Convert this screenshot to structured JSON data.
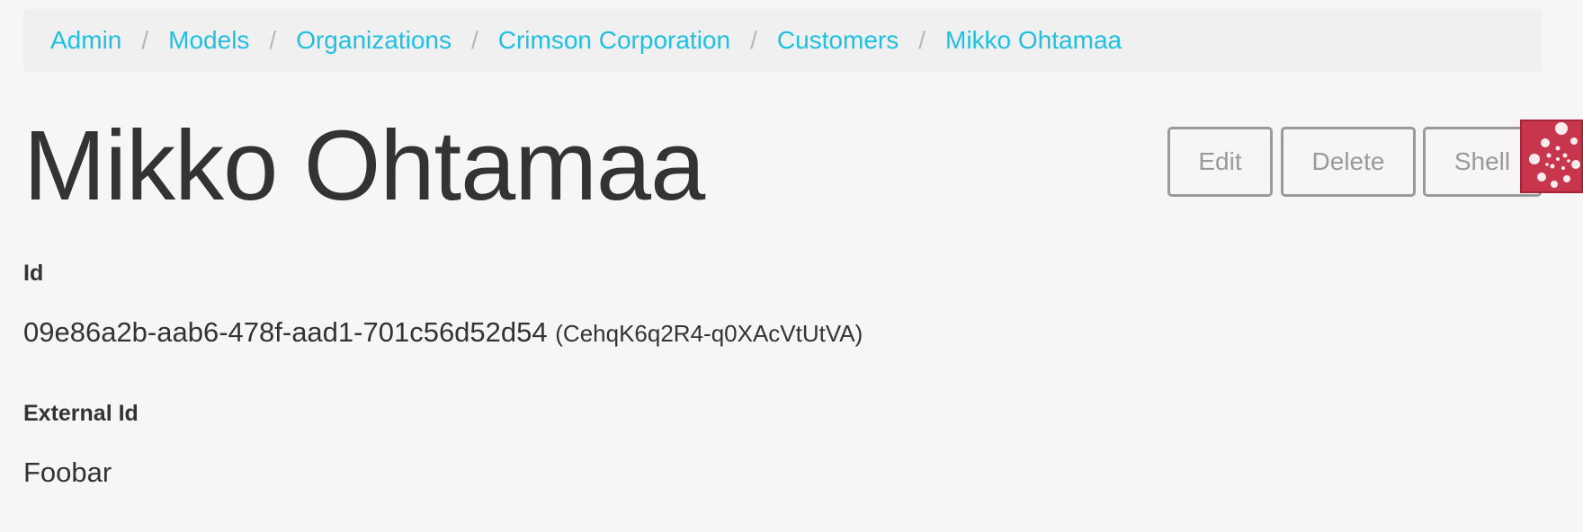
{
  "breadcrumb": {
    "items": [
      {
        "label": "Admin"
      },
      {
        "label": "Models"
      },
      {
        "label": "Organizations"
      },
      {
        "label": "Crimson Corporation"
      },
      {
        "label": "Customers"
      },
      {
        "label": "Mikko Ohtamaa"
      }
    ],
    "separator": "/"
  },
  "title": "Mikko Ohtamaa",
  "actions": {
    "edit_label": "Edit",
    "delete_label": "Delete",
    "shell_label": "Shell"
  },
  "overlay": {
    "icon": "spiral-dots-icon",
    "color": "#c8364d"
  },
  "fields": {
    "id": {
      "label": "Id",
      "value": "09e86a2b-aab6-478f-aad1-701c56d52d54",
      "short": "(CehqK6q2R4-q0XAcVtUtVA)"
    },
    "external_id": {
      "label": "External Id",
      "value": "Foobar"
    }
  },
  "colors": {
    "link": "#1fc0e2",
    "background": "#f6f6f6",
    "button_border": "#9a9a9a"
  }
}
